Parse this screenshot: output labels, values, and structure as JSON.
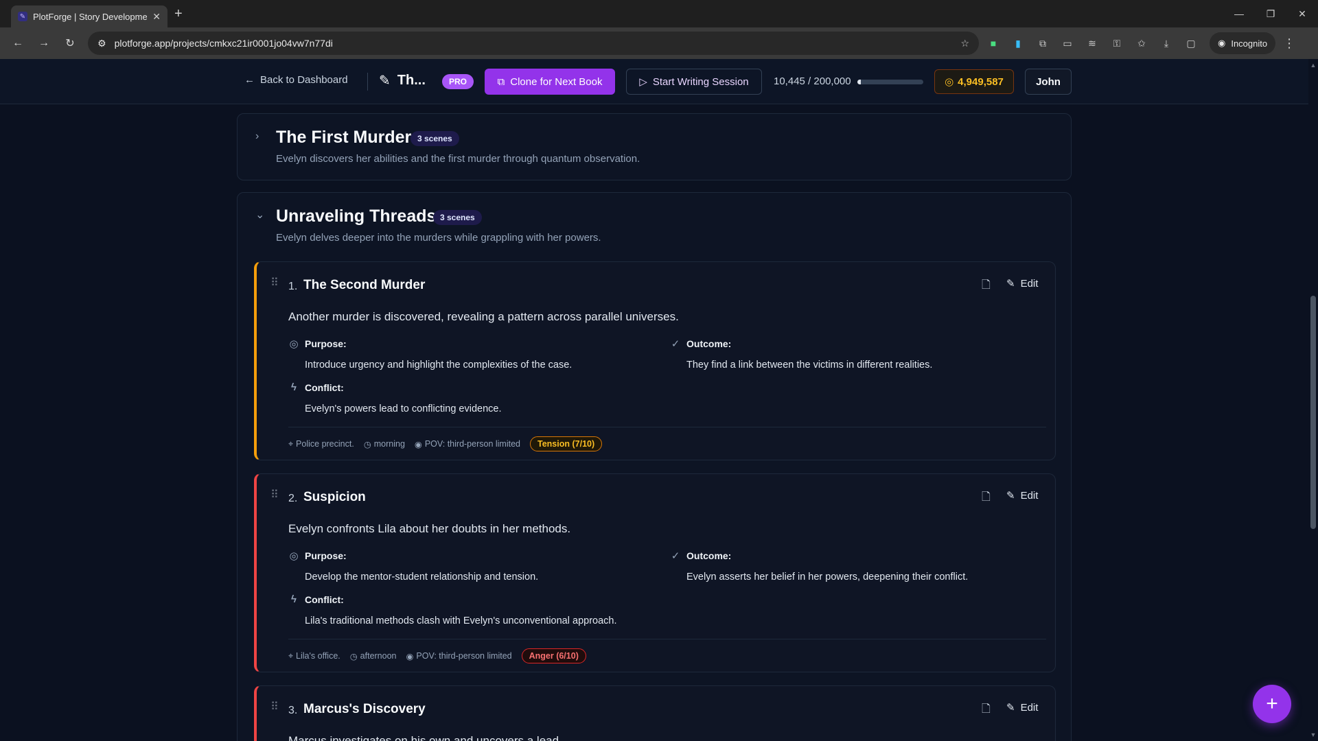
{
  "browser": {
    "tab_title": "PlotForge | Story Development",
    "url": "plotforge.app/projects/cmkxc21ir0001jo04vw7n77di",
    "incognito_label": "Incognito"
  },
  "header": {
    "back_label": "Back to Dashboard",
    "project_title": "Th...",
    "pro_label": "PRO",
    "clone_label": "Clone for Next Book",
    "write_label": "Start Writing Session",
    "word_count": "10,445 / 200,000",
    "word_progress_fraction": 0.052,
    "credits": "4,949,587",
    "user": "John"
  },
  "chapters": [
    {
      "title": "The First Murder",
      "badge": "3 scenes",
      "description": "Evelyn discovers her abilities and the first murder through quantum observation.",
      "expanded": false
    },
    {
      "title": "Unraveling Threads",
      "badge": "3 scenes",
      "description": "Evelyn delves deeper into the murders while grappling with her powers.",
      "expanded": true
    }
  ],
  "scenes": [
    {
      "number": "1.",
      "title": "The Second Murder",
      "summary": "Another murder is discovered, revealing a pattern across parallel universes.",
      "purpose_label": "Purpose:",
      "purpose": "Introduce urgency and highlight the complexities of the case.",
      "outcome_label": "Outcome:",
      "outcome": "They find a link between the victims in different realities.",
      "conflict_label": "Conflict:",
      "conflict": "Evelyn's powers lead to conflicting evidence.",
      "location": "Police precinct.",
      "time": "morning",
      "pov": "POV: third-person limited",
      "emotion": "Tension (7/10)",
      "accent": "#f59e0b",
      "edit_label": "Edit"
    },
    {
      "number": "2.",
      "title": "Suspicion",
      "summary": "Evelyn confronts Lila about her doubts in her methods.",
      "purpose_label": "Purpose:",
      "purpose": "Develop the mentor-student relationship and tension.",
      "outcome_label": "Outcome:",
      "outcome": "Evelyn asserts her belief in her powers, deepening their conflict.",
      "conflict_label": "Conflict:",
      "conflict": "Lila's traditional methods clash with Evelyn's unconventional approach.",
      "location": "Lila's office.",
      "time": "afternoon",
      "pov": "POV: third-person limited",
      "emotion": "Anger (6/10)",
      "accent": "#ef4444",
      "edit_label": "Edit"
    },
    {
      "number": "3.",
      "title": "Marcus's Discovery",
      "summary": "Marcus investigates on his own and uncovers a lead.",
      "accent": "#ef4444",
      "edit_label": "Edit"
    }
  ],
  "fab_label": "+"
}
